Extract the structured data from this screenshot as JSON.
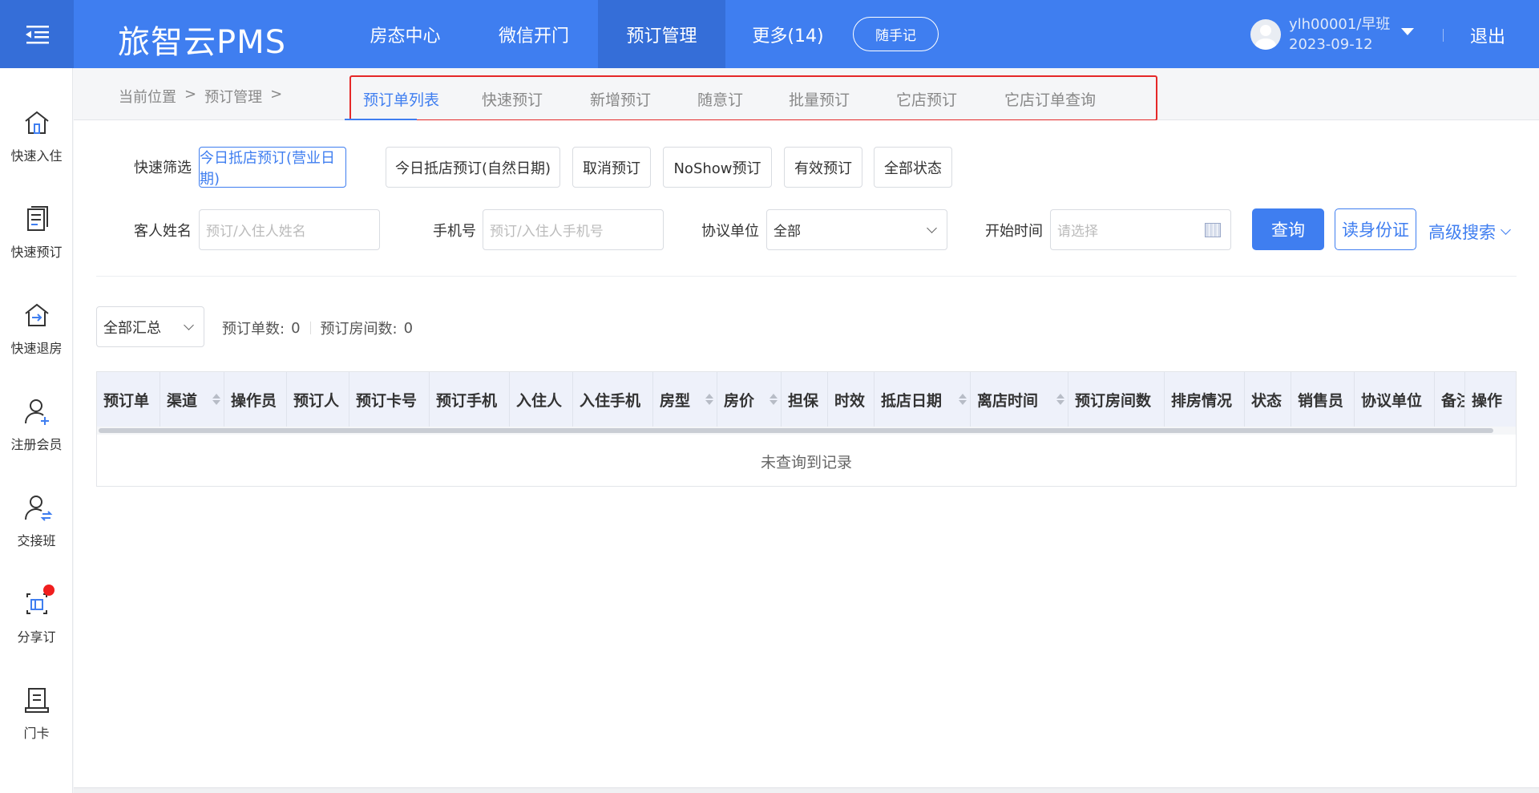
{
  "header": {
    "logo": "旅智云PMS",
    "nav": [
      "房态中心",
      "微信开门",
      "预订管理",
      "更多(14)"
    ],
    "active_nav": "预订管理",
    "note_button": "随手记",
    "user": {
      "name": "ylh00001/早班",
      "date": "2023-09-12"
    },
    "logout": "退出",
    "brand_color": "#3f7ef0"
  },
  "sidebar": {
    "items": [
      {
        "label": "快速入住",
        "icon": "home-icon"
      },
      {
        "label": "快速预订",
        "icon": "document-icon"
      },
      {
        "label": "快速退房",
        "icon": "checkout-icon"
      },
      {
        "label": "注册会员",
        "icon": "user-add-icon"
      },
      {
        "label": "交接班",
        "icon": "user-switch-icon"
      },
      {
        "label": "分享订",
        "icon": "share-icon"
      },
      {
        "label": "门卡",
        "icon": "card-icon"
      }
    ]
  },
  "breadcrumb": {
    "prefix": "当前位置",
    "sep": ">",
    "current": "预订管理"
  },
  "tabs": [
    "预订单列表",
    "快速预订",
    "新增预订",
    "随意订",
    "批量预订",
    "它店预订",
    "它店订单查询"
  ],
  "filters": {
    "quick_label": "快速筛选",
    "quick_chips": [
      "今日抵店预订(营业日期)",
      "今日抵店预订(自然日期)",
      "取消预订",
      "NoShow预订",
      "有效预订",
      "全部状态"
    ],
    "guest_label": "客人姓名",
    "guest_placeholder": "预订/入住人姓名",
    "phone_label": "手机号",
    "phone_placeholder": "预订/入住人手机号",
    "agreement_label": "协议单位",
    "agreement_value": "全部",
    "start_label": "开始时间",
    "start_placeholder": "请选择",
    "query_button": "查询",
    "id_button": "读身份证",
    "advanced": "高级搜索"
  },
  "summary": {
    "select": "全部汇总",
    "orders_label": "预订单数:",
    "orders_value": "0",
    "rooms_label": "预订房间数:",
    "rooms_value": "0"
  },
  "table": {
    "columns": [
      "预订单",
      "渠道",
      "操作员",
      "预订人",
      "预订卡号",
      "预订手机",
      "入住人",
      "入住手机",
      "房型",
      "房价",
      "担保",
      "时效",
      "抵店日期",
      "离店时间",
      "预订房间数",
      "排房情况",
      "状态",
      "销售员",
      "协议单位",
      "备注",
      "操作"
    ],
    "empty_text": "未查询到记录"
  }
}
